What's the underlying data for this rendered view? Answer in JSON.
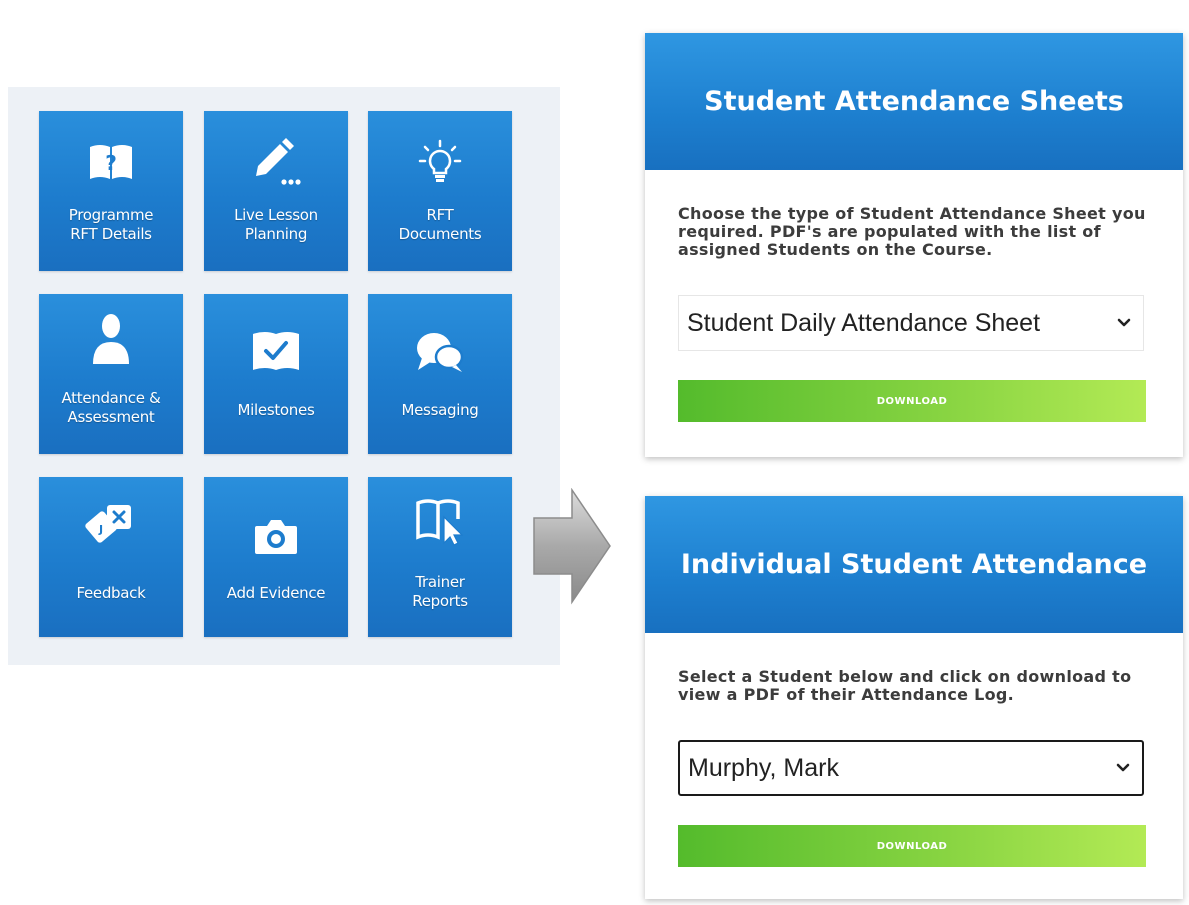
{
  "tiles": [
    {
      "label": "Programme\nRFT Details",
      "icon": "book-question-icon"
    },
    {
      "label": "Live Lesson\nPlanning",
      "icon": "pencil-icon"
    },
    {
      "label": "RFT\nDocuments",
      "icon": "lightbulb-icon"
    },
    {
      "label": "Attendance &\nAssessment",
      "icon": "person-icon"
    },
    {
      "label": "Milestones",
      "icon": "checkmark-icon"
    },
    {
      "label": "Messaging",
      "icon": "chat-bubbles-icon"
    },
    {
      "label": "Feedback",
      "icon": "feedback-cards-icon"
    },
    {
      "label": "Add Evidence",
      "icon": "camera-icon"
    },
    {
      "label": "Trainer\nReports",
      "icon": "book-cursor-icon"
    }
  ],
  "attendance_sheets": {
    "title": "Student Attendance Sheets",
    "description": "Choose the type of Student Attendance Sheet you required. PDF's are populated with the list of assigned Students on the Course.",
    "selected": "Student Daily Attendance Sheet",
    "download_label": "DOWNLOAD"
  },
  "individual_attendance": {
    "title": "Individual Student Attendance",
    "description": "Select a Student below and click on download to view a PDF of their Attendance Log.",
    "selected": "Murphy, Mark",
    "download_label": "DOWNLOAD"
  },
  "colors": {
    "tile_blue": "#1d7ccd",
    "header_blue": "#2389d8",
    "download_green": "#6cc437",
    "panel_bg": "#edf1f6"
  }
}
